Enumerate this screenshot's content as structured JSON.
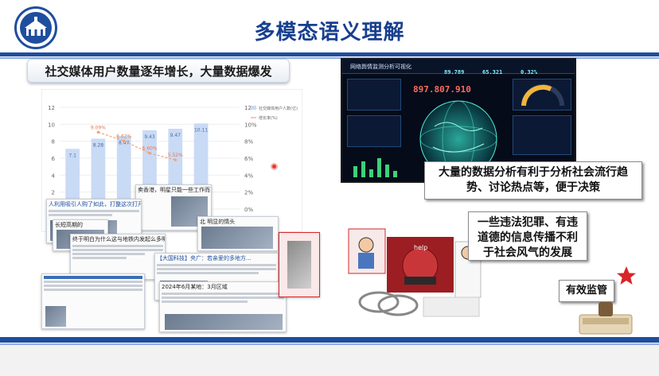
{
  "header": {
    "title": "多模态语义理解",
    "logo_icon": "university-building-icon"
  },
  "subtitle": "社交媒体用户数量逐年增长，大量数据爆发",
  "chart_data": {
    "type": "bar",
    "title": "",
    "categories": [
      "",
      "",
      "",
      "",
      "",
      "",
      ""
    ],
    "series": [
      {
        "name": "社交媒体用户人数(亿)",
        "values": [
          7.1,
          8.3,
          8.6,
          9.3,
          9.47,
          10.1,
          0
        ]
      },
      {
        "name": "增长率(%)",
        "values": [
          null,
          9.07,
          8.03,
          6.6,
          5.8,
          null,
          null
        ]
      }
    ],
    "bar_labels": [
      "7.1",
      "8.28",
      "8.47",
      "9.43",
      "9.47",
      "10.11",
      ""
    ],
    "line_labels": [
      "",
      "9.09%",
      "8.62%",
      "6.60%",
      "5.52%",
      "",
      ""
    ],
    "ylim": [
      0,
      12
    ],
    "y2lim": [
      0,
      12
    ],
    "yticks": [
      "0",
      "2",
      "4",
      "6",
      "8",
      "10",
      "12"
    ],
    "y2ticks": [
      "0%",
      "2%",
      "4%",
      "6%",
      "8%",
      "10%",
      "12%"
    ],
    "legend": [
      "社交媒体用户人数(亿)",
      "增长率(%)"
    ],
    "legend_position": "right",
    "colors": {
      "bar": "#c9daf5",
      "line": "#f3a27a"
    }
  },
  "collage": {
    "cards": [
      {
        "text": "卖香港，明星只能一些工作而已"
      },
      {
        "text": "人利用吸引人购了如此，打整这次打开了"
      },
      {
        "text": "长短高期的"
      },
      {
        "text": "北 明显的情头"
      },
      {
        "text": "终于明白为什么这与地铁内发起么多明白了!(转)"
      },
      {
        "text": "【大国科技】央广：若亲爱的多地方..."
      },
      {
        "text": "2024年6月某地：3月区域"
      }
    ]
  },
  "dashboard": {
    "title": "网络舆情监测分析可视化",
    "big_number": "897.807.910",
    "stats": [
      "89.789",
      "65.321",
      "0.32%"
    ]
  },
  "callouts": {
    "analysis": "大量的数据分析有利于分析社会流行趋势、讨论热点等，便于决策",
    "crime": "一些违法犯罪、有违道德的信息传播不利于社会风气的发展",
    "supervise": "有效监管"
  },
  "illustration": {
    "help_text": "help"
  },
  "colors": {
    "brand_blue": "#1f4e9e",
    "title_blue": "#173f8f",
    "accent_red": "#d8252a"
  }
}
